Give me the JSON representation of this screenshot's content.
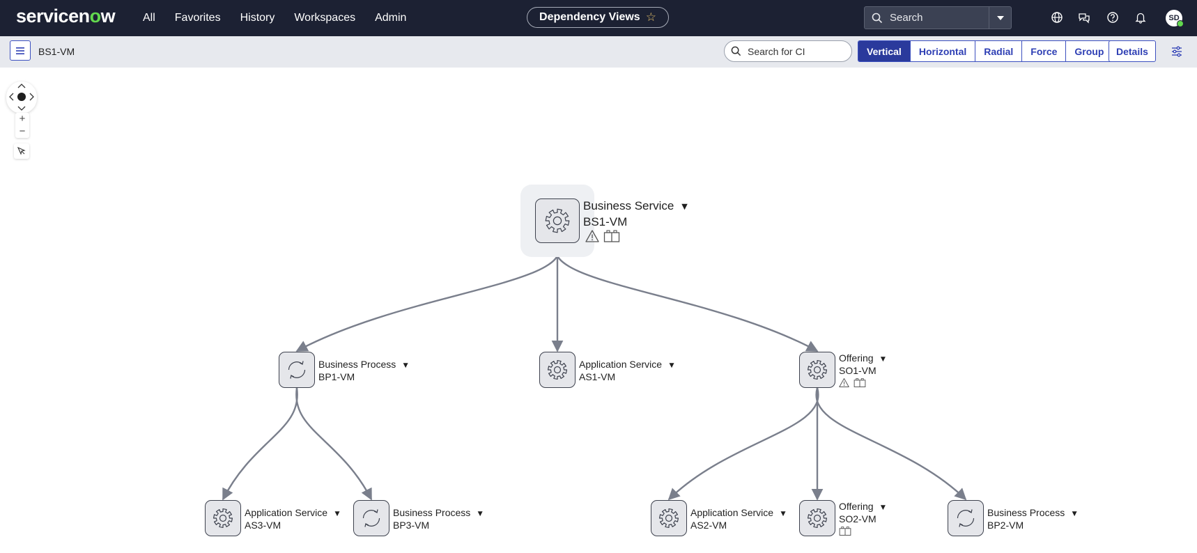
{
  "header": {
    "logo_text_a": "servicen",
    "logo_text_o": "o",
    "logo_text_b": "w",
    "nav": [
      "All",
      "Favorites",
      "History",
      "Workspaces",
      "Admin"
    ],
    "page_title": "Dependency Views",
    "search_placeholder": "Search",
    "user_initials": "SD"
  },
  "toolbar": {
    "breadcrumb": "BS1-VM",
    "ci_search_placeholder": "Search for CI",
    "layouts": [
      "Vertical",
      "Horizontal",
      "Radial",
      "Force",
      "Group"
    ],
    "active_layout": "Vertical",
    "details_label": "Details"
  },
  "graph": {
    "nodes": [
      {
        "id": "bs1",
        "type": "Business Service",
        "name": "BS1-VM",
        "icon": "gear-icon",
        "root": true,
        "badges": [
          "warning-icon",
          "package-icon"
        ]
      },
      {
        "id": "bp1",
        "type": "Business Process",
        "name": "BP1-VM",
        "icon": "refresh-icon",
        "badges": []
      },
      {
        "id": "as1",
        "type": "Application Service",
        "name": "AS1-VM",
        "icon": "gear-icon",
        "badges": []
      },
      {
        "id": "so1",
        "type": "Offering",
        "name": "SO1-VM",
        "icon": "gear-icon",
        "badges": [
          "warning-icon",
          "package-icon"
        ]
      },
      {
        "id": "as3",
        "type": "Application Service",
        "name": "AS3-VM",
        "icon": "gear-icon",
        "badges": []
      },
      {
        "id": "bp3",
        "type": "Business Process",
        "name": "BP3-VM",
        "icon": "refresh-icon",
        "badges": []
      },
      {
        "id": "as2",
        "type": "Application Service",
        "name": "AS2-VM",
        "icon": "gear-icon",
        "badges": []
      },
      {
        "id": "so2",
        "type": "Offering",
        "name": "SO2-VM",
        "icon": "gear-icon",
        "badges": [
          "package-icon"
        ]
      },
      {
        "id": "bp2",
        "type": "Business Process",
        "name": "BP2-VM",
        "icon": "refresh-icon",
        "badges": []
      }
    ],
    "edges": [
      [
        "bs1",
        "bp1"
      ],
      [
        "bs1",
        "as1"
      ],
      [
        "bs1",
        "so1"
      ],
      [
        "bp1",
        "as3"
      ],
      [
        "bp1",
        "bp3"
      ],
      [
        "so1",
        "as2"
      ],
      [
        "so1",
        "so2"
      ],
      [
        "so1",
        "bp2"
      ]
    ]
  }
}
